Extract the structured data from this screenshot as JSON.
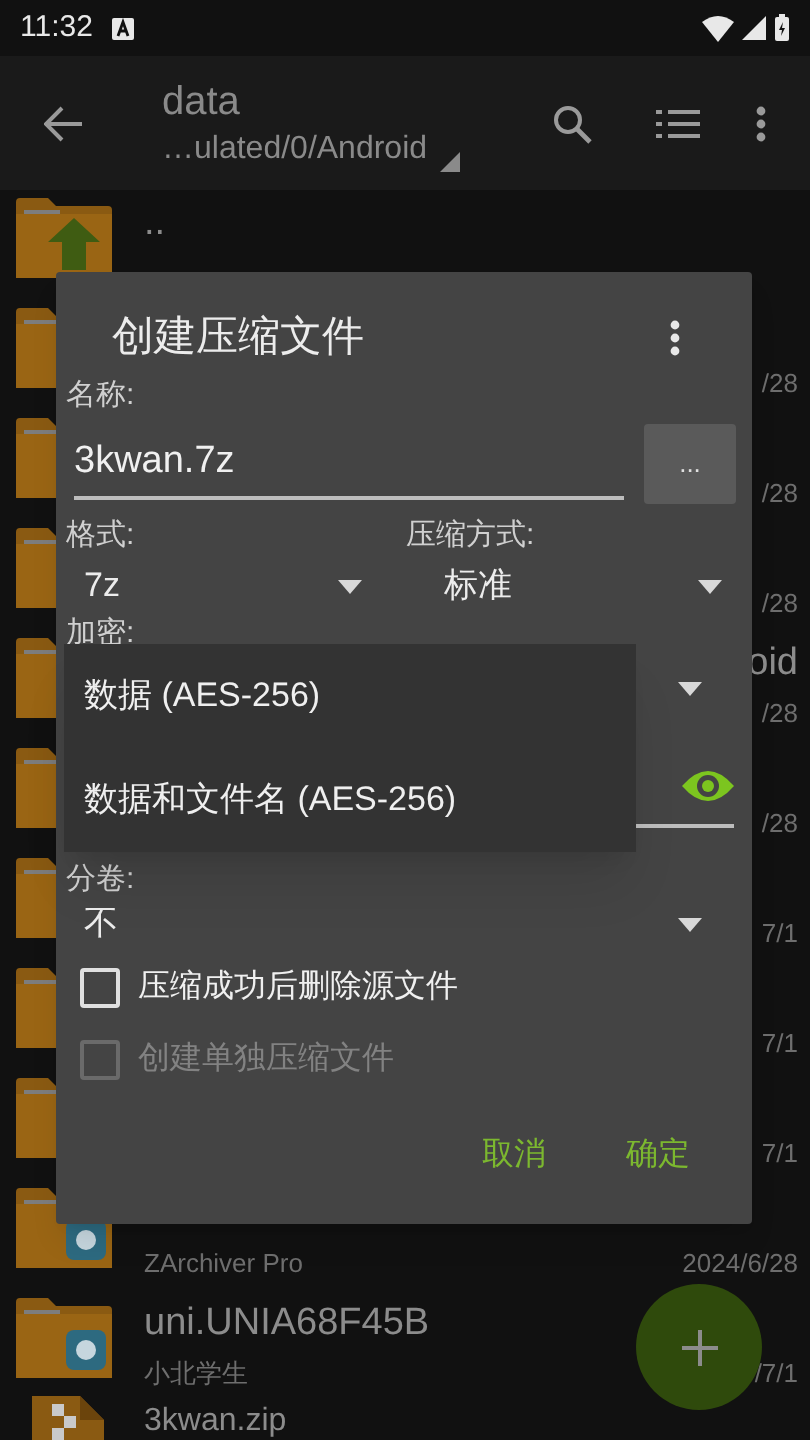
{
  "status_bar": {
    "time": "11:32"
  },
  "toolbar": {
    "title": "data",
    "path": "…ulated/0/Android"
  },
  "files": [
    {
      "kind": "up",
      "title": ".."
    },
    {
      "kind": "folder",
      "date": "/28"
    },
    {
      "kind": "folder",
      "date": "/28"
    },
    {
      "kind": "folder",
      "date": "/28"
    },
    {
      "kind": "folder",
      "title": "oid",
      "date": "/28"
    },
    {
      "kind": "folder",
      "date": "/28"
    },
    {
      "kind": "folder",
      "date": "7/1"
    },
    {
      "kind": "folder",
      "date": "7/1"
    },
    {
      "kind": "folder",
      "date": "7/1"
    },
    {
      "kind": "app_folder",
      "subtitle": "ZArchiver Pro",
      "date": "2024/6/28"
    },
    {
      "kind": "app_folder",
      "title": "uni.UNIA68F45B",
      "subtitle": "小北学生",
      "date": "/7/1"
    },
    {
      "kind": "zip",
      "title": "3kwan.zip"
    }
  ],
  "dialog": {
    "title": "创建压缩文件",
    "name_label": "名称:",
    "name_value": "3kwan.7z",
    "browse_button": "...",
    "format_label": "格式:",
    "format_value": "7z",
    "method_label": "压缩方式:",
    "method_value": "标准",
    "encryption_label": "加密:",
    "split_label": "分卷:",
    "split_value": "不",
    "options": [
      {
        "label": "压缩成功后删除源文件",
        "checked": false,
        "disabled": false
      },
      {
        "label": "创建单独压缩文件",
        "checked": false,
        "disabled": true
      }
    ],
    "buttons": [
      "取消",
      "确定"
    ]
  },
  "encryption_menu": {
    "items": [
      "数据 (AES-256)",
      "数据和文件名 (AES-256)"
    ]
  }
}
